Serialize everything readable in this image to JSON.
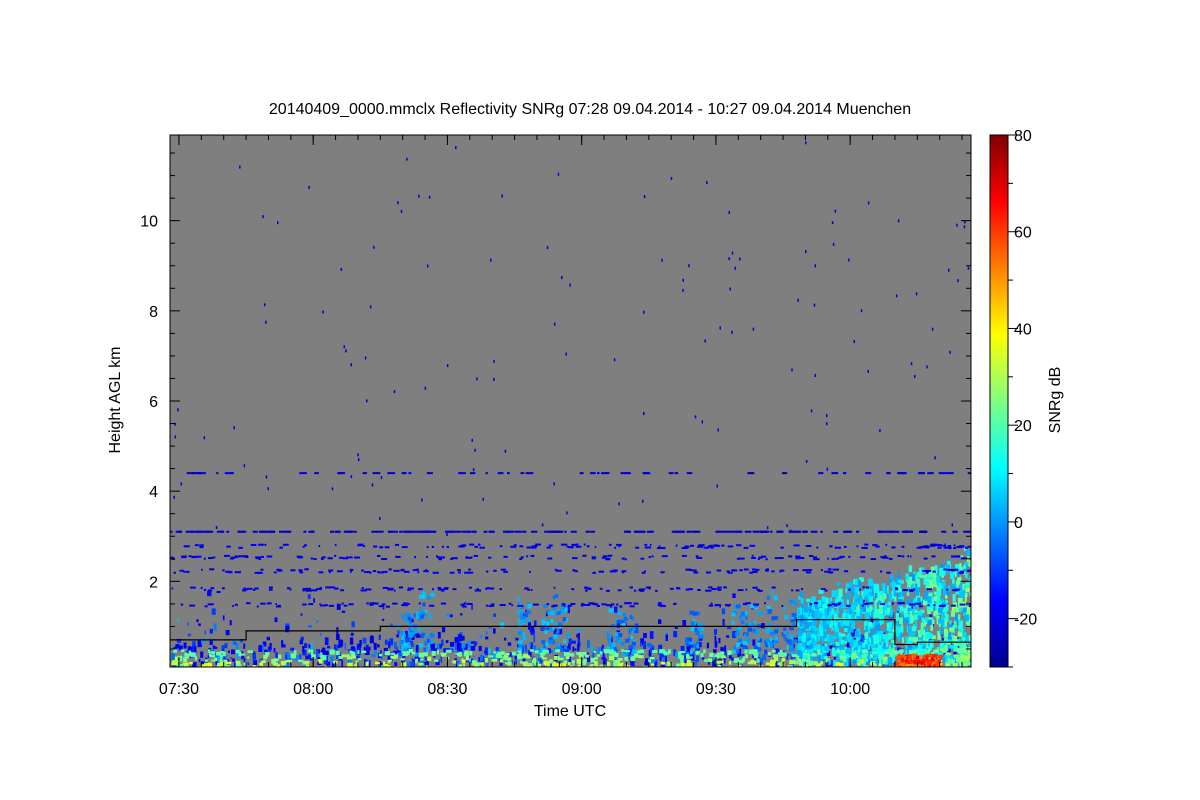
{
  "chart_data": {
    "type": "heatmap",
    "title": "20140409_0000.mmclx Reflectivity SNRg   07:28 09.04.2014 - 10:27 09.04.2014 Muenchen",
    "xlabel": "Time UTC",
    "ylabel": "Height AGL km",
    "x_range": [
      "07:28",
      "10:27"
    ],
    "x_ticks": [
      "07:30",
      "08:00",
      "08:30",
      "09:00",
      "09:30",
      "10:00"
    ],
    "y_range": [
      0.1,
      11.9
    ],
    "y_ticks": [
      "2",
      "4",
      "6",
      "8",
      "10"
    ],
    "colorbar": {
      "label": "SNRg dB",
      "range": [
        -30,
        80
      ],
      "ticks": [
        "-20",
        "0",
        "20",
        "40",
        "60",
        "80"
      ],
      "colormap": "jet"
    },
    "background_color": "#7f7f7f",
    "features": [
      {
        "name": "near-surface strong echo layer",
        "height_km": [
          0.1,
          0.5
        ],
        "snr_db": [
          20,
          45
        ]
      },
      {
        "name": "low boundary-layer echoes",
        "height_km": [
          0.2,
          1.5
        ],
        "snr_db": [
          -20,
          10
        ]
      },
      {
        "name": "convective cells after 09:48",
        "time": [
          "09:48",
          "10:27"
        ],
        "height_km": [
          0.2,
          2.6
        ],
        "snr_db": [
          0,
          30
        ]
      },
      {
        "name": "strong precipitation core",
        "time": [
          "10:10",
          "10:20"
        ],
        "height_km": [
          0.1,
          0.4
        ],
        "snr_db": [
          50,
          70
        ]
      },
      {
        "name": "scattered echo line near 3.1 km",
        "height_km": 3.1,
        "snr_db": -20
      },
      {
        "name": "scattered echo line near 4.4 km",
        "height_km": 4.4,
        "snr_db": -20
      }
    ],
    "boundary_line_km": [
      {
        "t": "07:28",
        "h": 0.7
      },
      {
        "t": "07:45",
        "h": 0.7
      },
      {
        "t": "07:45",
        "h": 0.9
      },
      {
        "t": "08:15",
        "h": 0.9
      },
      {
        "t": "08:15",
        "h": 1.0
      },
      {
        "t": "09:48",
        "h": 1.0
      },
      {
        "t": "09:48",
        "h": 1.15
      },
      {
        "t": "10:10",
        "h": 1.15
      },
      {
        "t": "10:10",
        "h": 0.6
      },
      {
        "t": "10:15",
        "h": 0.6
      },
      {
        "t": "10:15",
        "h": 0.65
      },
      {
        "t": "10:27",
        "h": 0.65
      }
    ]
  }
}
